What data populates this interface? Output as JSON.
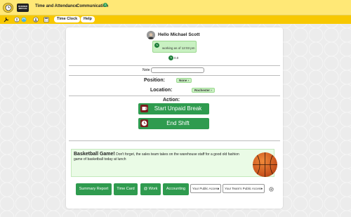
{
  "header": {
    "logo_box_text": "DUNDER MIFFLIN",
    "nav": [
      "Time and Attendance",
      "Communication"
    ],
    "comm_badge": "2"
  },
  "toolbar": {
    "icons": [
      "wrench-icon",
      "avatar-icon",
      "sync-icon",
      "people-icon",
      "calculator-icon"
    ],
    "buttons": [
      "Time Clock",
      "Help"
    ]
  },
  "user": {
    "greeting": "Hello Michael Scott",
    "status": "working as of 12:03 pm",
    "hours": "0.0"
  },
  "note": {
    "label": "Note",
    "value": "",
    "placeholder": ""
  },
  "position": {
    "label": "Position:",
    "value": "None"
  },
  "location": {
    "label": "Location:",
    "value": "Rochester"
  },
  "action": {
    "label": "Action:",
    "start_break": "Start Unpaid Break",
    "end_shift": "End Shift"
  },
  "announcement": {
    "title": "Basketball Game!",
    "text": " Don't forget, the sales team takes on the warehouse staff for a good old fashion game of basketball today at lunch"
  },
  "footer": {
    "buttons": [
      "Summary Report",
      "Time Card",
      "@ Work",
      "Accounting"
    ],
    "selects": [
      "Your Public Access",
      "Your Team's Public Access"
    ]
  },
  "colors": {
    "topbar": "#ffe876",
    "toolbar": "#f7c800",
    "primary_green": "#2f9b4f",
    "pill_green": "#c9f1c2"
  }
}
